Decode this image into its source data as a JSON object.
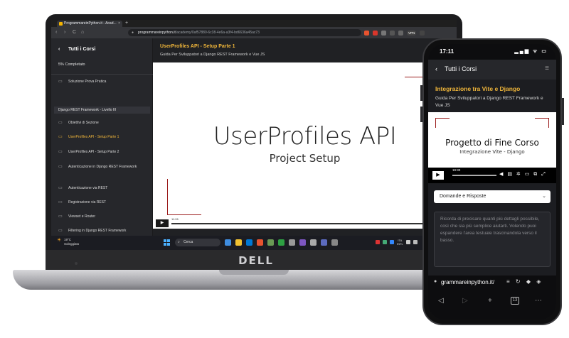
{
  "laptop": {
    "brand": "DELL",
    "browser": {
      "tab_title": "ProgrammareinPython.it - Acad...",
      "tab_close": "×",
      "new_tab": "+",
      "nav": {
        "back": "‹",
        "forward": "›",
        "reload": "C",
        "home": "⌂"
      },
      "url_host": "programmareinpython.it",
      "url_path": "/academy/0af57880-6c38-4e6a-a3f4-bd6636a45ac73",
      "vpn_label": "VPN"
    },
    "sidebar": {
      "back_glyph": "‹",
      "title": "Tutti i Corsi",
      "progress": "5% Completato",
      "section": "Django REST Framework - Livello III",
      "items": [
        {
          "label": "Soluzione Prova Pratica"
        },
        {
          "label": "Obiettivi di Sezione"
        },
        {
          "label": "UserProfiles API - Setup Parte 1"
        },
        {
          "label": "UserProfiles API - Setup Parte 2"
        },
        {
          "label": "Autenticazione in Django REST Framework"
        },
        {
          "label": "Autenticazione via REST"
        },
        {
          "label": "Registrazione via REST"
        },
        {
          "label": "Viewset e Router"
        },
        {
          "label": "Filtering in Django REST Framework"
        },
        {
          "label": "I Test Automatizzati - Parte 1"
        }
      ]
    },
    "lesson": {
      "title": "UserProfiles API - Setup Parte 1",
      "subtitle": "Guida Per Sviluppatori a Django REST Framework e Vue JS",
      "slide_title": "UserProfiles API",
      "slide_subtitle": "Project Setup",
      "video_time": "11:26",
      "play_glyph": "▶"
    },
    "taskbar": {
      "weather_temp": "19°C",
      "weather_desc": "Soleggiato",
      "search_placeholder": "Cerca",
      "tray_lang_1": "ITA",
      "tray_lang_2": "INTL"
    }
  },
  "phone": {
    "status_time": "17:11",
    "status_icons": "▂▄▆ ᯤ ▭",
    "nav_back": "‹",
    "nav_title": "Tutti i Corsi",
    "nav_menu": "≡",
    "lesson_title": "Integrazione tra Vite e Django",
    "lesson_subtitle": "Guida Per Sviluppatori a Django REST Framework e Vue JS",
    "slide_title": "Progetto di Fine Corso",
    "slide_subtitle": "Integrazione Vite - Django",
    "video_time": "19:30",
    "play_glyph": "▶",
    "select_value": "Domande e Risposte",
    "select_chevron": "⌄",
    "textarea_placeholder": "Ricorda di precisare quanti più dettagli possibile, così che sia più semplice aiutarti. Volendo puoi espandere l'area testuale trascinandola verso il basso.",
    "url_text": "grammareinpython.it/",
    "tab_count": "13"
  },
  "colors": {
    "accent": "#f0b63a",
    "sidebar_bg": "#26272b",
    "deco_red": "#9b1c1c"
  }
}
